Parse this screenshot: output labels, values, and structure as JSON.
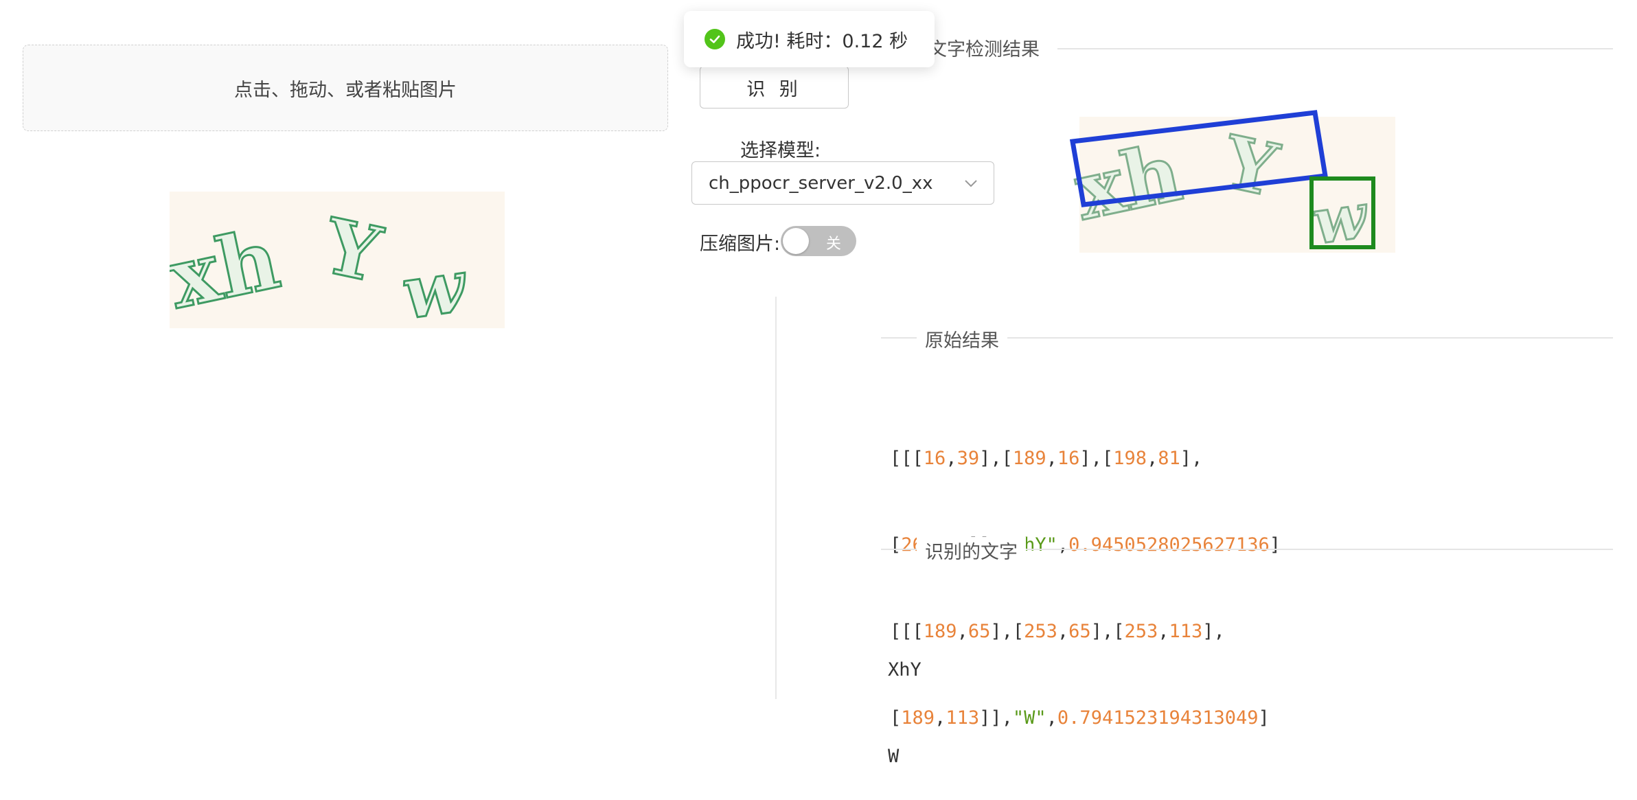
{
  "upload": {
    "hint": "点击、拖动、或者粘贴图片"
  },
  "toast": {
    "message": "成功! 耗时：0.12 秒"
  },
  "recognize_button": {
    "label": "识 别"
  },
  "model": {
    "label": "选择模型:",
    "selected": "ch_ppocr_server_v2.0_xx"
  },
  "compress": {
    "label": "压缩图片:",
    "toggle_text": "关",
    "enabled": false
  },
  "sections": {
    "detection": "文字检测结果",
    "raw": "原始结果",
    "text": "识别的文字"
  },
  "raw_result": {
    "line1_tokens": [
      {
        "t": "[[[",
        "c": "p"
      },
      {
        "t": "16",
        "c": "n"
      },
      {
        "t": ",",
        "c": "p"
      },
      {
        "t": "39",
        "c": "n"
      },
      {
        "t": "],[",
        "c": "p"
      },
      {
        "t": "189",
        "c": "n"
      },
      {
        "t": ",",
        "c": "p"
      },
      {
        "t": "16",
        "c": "n"
      },
      {
        "t": "],[",
        "c": "p"
      },
      {
        "t": "198",
        "c": "n"
      },
      {
        "t": ",",
        "c": "p"
      },
      {
        "t": "81",
        "c": "n"
      },
      {
        "t": "],",
        "c": "p"
      }
    ],
    "line2_tokens": [
      {
        "t": "[",
        "c": "p"
      },
      {
        "t": "26",
        "c": "n"
      },
      {
        "t": ",",
        "c": "p"
      },
      {
        "t": "105",
        "c": "n"
      },
      {
        "t": "]],",
        "c": "p"
      },
      {
        "t": "\"XhY\"",
        "c": "s"
      },
      {
        "t": ",",
        "c": "p"
      },
      {
        "t": "0.9450528025627136",
        "c": "n"
      },
      {
        "t": "]",
        "c": "p"
      }
    ],
    "line3_tokens": [
      {
        "t": "[[[",
        "c": "p"
      },
      {
        "t": "189",
        "c": "n"
      },
      {
        "t": ",",
        "c": "p"
      },
      {
        "t": "65",
        "c": "n"
      },
      {
        "t": "],[",
        "c": "p"
      },
      {
        "t": "253",
        "c": "n"
      },
      {
        "t": ",",
        "c": "p"
      },
      {
        "t": "65",
        "c": "n"
      },
      {
        "t": "],[",
        "c": "p"
      },
      {
        "t": "253",
        "c": "n"
      },
      {
        "t": ",",
        "c": "p"
      },
      {
        "t": "113",
        "c": "n"
      },
      {
        "t": "],",
        "c": "p"
      }
    ],
    "line4_tokens": [
      {
        "t": "[",
        "c": "p"
      },
      {
        "t": "189",
        "c": "n"
      },
      {
        "t": ",",
        "c": "p"
      },
      {
        "t": "113",
        "c": "n"
      },
      {
        "t": "]],",
        "c": "p"
      },
      {
        "t": "\"W\"",
        "c": "s"
      },
      {
        "t": ",",
        "c": "p"
      },
      {
        "t": "0.7941523194313049",
        "c": "n"
      },
      {
        "t": "]",
        "c": "p"
      }
    ]
  },
  "recognized_text": {
    "line1": "XhY",
    "line2": "W"
  },
  "captcha": {
    "preview_text": "xhYw",
    "result_text_1": "xhY",
    "result_text_2": "w"
  },
  "colors": {
    "success": "#52c41a",
    "box1": "#1f3fd6",
    "box2": "#1e8a1e",
    "number": "#e8833a",
    "string": "#5a9a1a"
  }
}
